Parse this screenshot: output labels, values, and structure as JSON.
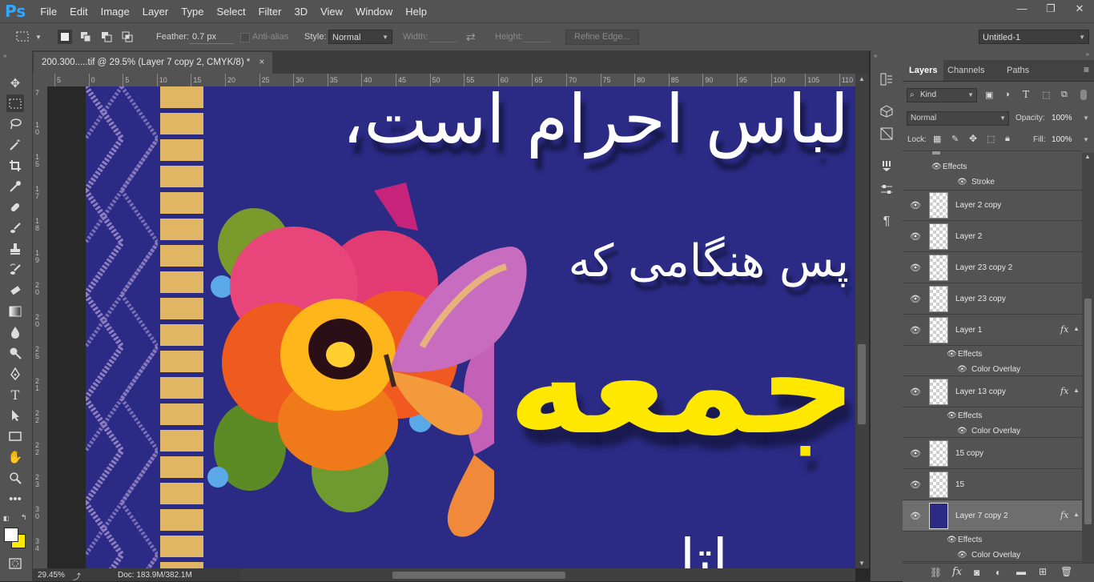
{
  "app": {
    "logo": "Ps"
  },
  "menu": [
    "File",
    "Edit",
    "Image",
    "Layer",
    "Type",
    "Select",
    "Filter",
    "3D",
    "View",
    "Window",
    "Help"
  ],
  "window_controls": {
    "minimize": "—",
    "restore": "❐",
    "close": "✕"
  },
  "options": {
    "feather_label": "Feather:",
    "feather_value": "0.7 px",
    "antialias_label": "Anti-alias",
    "style_label": "Style:",
    "style_value": "Normal",
    "width_label": "Width:",
    "height_label": "Height:",
    "refine_edge": "Refine Edge...",
    "workspace": "Untitled-1"
  },
  "document": {
    "tab_title": "200.300.....tif @ 29.5% (Layer 7 copy 2, CMYK/8) *",
    "close_glyph": "×"
  },
  "ruler": {
    "h_ticks": [
      "5",
      "0",
      "5",
      "10",
      "15",
      "20",
      "25",
      "30",
      "35",
      "40",
      "45",
      "50",
      "55",
      "60",
      "65",
      "70",
      "75",
      "80",
      "85",
      "90",
      "95",
      "100",
      "105",
      "110"
    ],
    "v_ticks": [
      "7",
      "1\n0",
      "1\n5",
      "1\n7",
      "1\n8",
      "1\n9",
      "2\n0",
      "2\n0",
      "2\n5",
      "2\n1",
      "2\n2",
      "2\n2",
      "2\n3",
      "3\n0",
      "3\n4"
    ]
  },
  "artwork": {
    "line1": "لباس احرام است،",
    "line2": "پس هنگامی که",
    "line3": "جمعه",
    "line4": "... اتا",
    "colors": {
      "background": "#2b2b86",
      "yellow": "#ffe800",
      "gold": "#e0b564",
      "pattern": "#8d7ec0"
    }
  },
  "status": {
    "zoom": "29.45%",
    "doc": "Doc: 183.9M/382.1M"
  },
  "panel": {
    "tabs": [
      "Layers",
      "Channels",
      "Paths"
    ],
    "filter_kind": "Kind",
    "blend_mode": "Normal",
    "opacity_label": "Opacity:",
    "opacity_value": "100%",
    "lock_label": "Lock:",
    "fill_label": "Fill:",
    "fill_value": "100%",
    "top_effects": "Effects",
    "top_stroke": "Stroke",
    "layers": [
      {
        "name": "Layer 2 copy",
        "fx": ""
      },
      {
        "name": "Layer 2",
        "fx": ""
      },
      {
        "name": "Layer 23 copy 2",
        "fx": ""
      },
      {
        "name": "Layer 23 copy",
        "fx": ""
      },
      {
        "name": "Layer 1",
        "fx": "fx",
        "effects": "Effects",
        "effect_item": "Color Overlay"
      },
      {
        "name": "Layer 13 copy",
        "fx": "fx",
        "effects": "Effects",
        "effect_item": "Color Overlay"
      },
      {
        "name": "15 copy",
        "fx": ""
      },
      {
        "name": "15",
        "fx": ""
      },
      {
        "name": "Layer 7 copy 2",
        "fx": "fx",
        "effects": "Effects",
        "effect_item": "Color Overlay"
      }
    ],
    "bottom_icons": [
      "link-icon",
      "fx-icon",
      "mask-icon",
      "adjustment-icon",
      "folder-icon",
      "new-layer-icon",
      "trash-icon"
    ]
  }
}
